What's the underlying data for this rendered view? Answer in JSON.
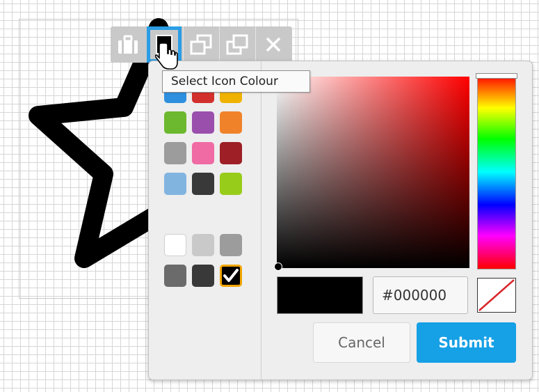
{
  "toolbar": {
    "buttons": [
      {
        "name": "briefcase-icon",
        "action": "group"
      },
      {
        "name": "color-square-icon",
        "action": "select-icon-colour",
        "active": true
      },
      {
        "name": "bring-forward-icon",
        "action": "bring-forward"
      },
      {
        "name": "send-backward-icon",
        "action": "send-backward"
      },
      {
        "name": "close-icon",
        "action": "delete"
      }
    ]
  },
  "tooltip": {
    "text": "Select Icon Colour"
  },
  "palette": {
    "colors": [
      "#2e8fde",
      "#d2302c",
      "#f0b200",
      "#6cb82e",
      "#9b4fad",
      "#f0822a",
      "#9c9c9c",
      "#f06aa4",
      "#9e1f26",
      "#82b4e0",
      "#393939",
      "#98cc1a"
    ],
    "greys": [
      "#ffffff",
      "#c9c9c9",
      "#9c9c9c",
      "#6b6b6b",
      "#393939",
      "#000000"
    ],
    "selected": "#000000"
  },
  "picker": {
    "hue_color": "#ff0000",
    "hex_value": "#000000",
    "preview_color": "#000000"
  },
  "buttons": {
    "cancel": "Cancel",
    "submit": "Submit"
  },
  "star_color": "#000000"
}
